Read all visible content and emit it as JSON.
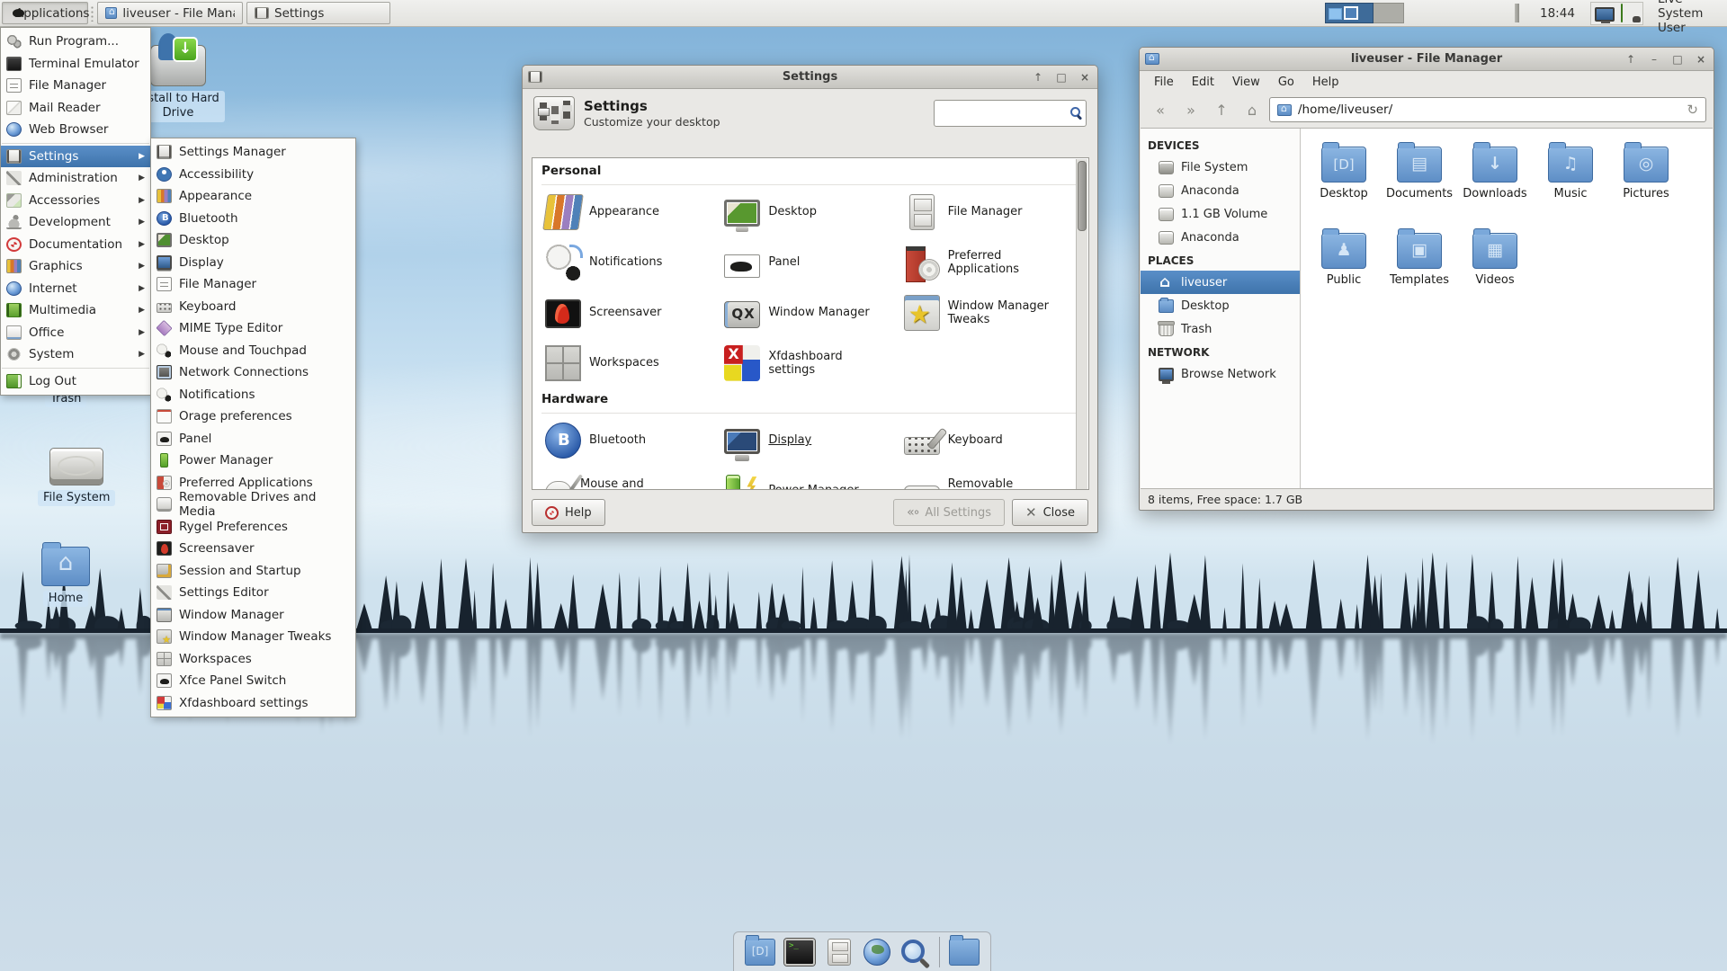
{
  "panel": {
    "applications_label": "Applications",
    "taskbar": [
      {
        "icon": "home-folder-icon",
        "label": "liveuser - File Manager"
      },
      {
        "icon": "settings-icon",
        "label": "Settings"
      }
    ],
    "workspaces": {
      "count": 2,
      "active": 1
    },
    "clock": "18:44",
    "tray": [
      {
        "icon": "display-tray-icon"
      },
      {
        "icon": "power-tray-icon"
      }
    ],
    "user_label": "Live System User"
  },
  "apps_menu": {
    "items": [
      {
        "icon": "run-program-icon",
        "label": "Run Program..."
      },
      {
        "icon": "terminal-icon",
        "label": "Terminal Emulator"
      },
      {
        "icon": "file-manager-icon",
        "label": "File Manager"
      },
      {
        "icon": "mail-icon",
        "label": "Mail Reader"
      },
      {
        "icon": "web-browser-icon",
        "label": "Web Browser"
      },
      {
        "icon": "settings-icon",
        "label": "Settings",
        "submenu": true,
        "highlighted": true
      },
      {
        "icon": "administration-icon",
        "label": "Administration",
        "submenu": true
      },
      {
        "icon": "accessories-icon",
        "label": "Accessories",
        "submenu": true
      },
      {
        "icon": "development-icon",
        "label": "Development",
        "submenu": true
      },
      {
        "icon": "documentation-icon",
        "label": "Documentation",
        "submenu": true
      },
      {
        "icon": "graphics-icon",
        "label": "Graphics",
        "submenu": true
      },
      {
        "icon": "internet-icon",
        "label": "Internet",
        "submenu": true
      },
      {
        "icon": "multimedia-icon",
        "label": "Multimedia",
        "submenu": true
      },
      {
        "icon": "office-icon",
        "label": "Office",
        "submenu": true
      },
      {
        "icon": "system-icon",
        "label": "System",
        "submenu": true
      },
      {
        "icon": "log-out-icon",
        "label": "Log Out"
      }
    ]
  },
  "settings_submenu": {
    "items": [
      {
        "icon": "settings-manager-icon",
        "label": "Settings Manager"
      },
      {
        "icon": "accessibility-icon",
        "label": "Accessibility"
      },
      {
        "icon": "appearance-icon",
        "label": "Appearance"
      },
      {
        "icon": "bluetooth-icon",
        "label": "Bluetooth"
      },
      {
        "icon": "desktop-icon",
        "label": "Desktop"
      },
      {
        "icon": "display-icon",
        "label": "Display"
      },
      {
        "icon": "file-manager-icon",
        "label": "File Manager"
      },
      {
        "icon": "keyboard-icon",
        "label": "Keyboard"
      },
      {
        "icon": "mime-type-icon",
        "label": "MIME Type Editor"
      },
      {
        "icon": "mouse-touchpad-icon",
        "label": "Mouse and Touchpad"
      },
      {
        "icon": "network-icon",
        "label": "Network Connections"
      },
      {
        "icon": "notifications-icon",
        "label": "Notifications"
      },
      {
        "icon": "orage-calendar-icon",
        "label": "Orage preferences"
      },
      {
        "icon": "panel-icon",
        "label": "Panel"
      },
      {
        "icon": "power-manager-icon",
        "label": "Power Manager"
      },
      {
        "icon": "preferred-applications-icon",
        "label": "Preferred Applications"
      },
      {
        "icon": "removable-drives-icon",
        "label": "Removable Drives and Media"
      },
      {
        "icon": "rygel-icon",
        "label": "Rygel Preferences"
      },
      {
        "icon": "screensaver-icon",
        "label": "Screensaver"
      },
      {
        "icon": "session-startup-icon",
        "label": "Session and Startup"
      },
      {
        "icon": "settings-editor-icon",
        "label": "Settings Editor"
      },
      {
        "icon": "window-manager-icon",
        "label": "Window Manager"
      },
      {
        "icon": "window-manager-tweaks-icon",
        "label": "Window Manager Tweaks"
      },
      {
        "icon": "workspaces-icon",
        "label": "Workspaces"
      },
      {
        "icon": "xfce-panel-switch-icon",
        "label": "Xfce Panel Switch"
      },
      {
        "icon": "xfdashboard-icon",
        "label": "Xfdashboard settings"
      }
    ]
  },
  "settings_window": {
    "title": "Settings",
    "heading": "Settings",
    "subheading": "Customize your desktop",
    "search_value": "",
    "sections": [
      {
        "title": "Personal",
        "tiles": [
          {
            "icon": "appearance-icon",
            "label": "Appearance"
          },
          {
            "icon": "desktop-icon",
            "label": "Desktop"
          },
          {
            "icon": "file-manager-icon",
            "label": "File Manager"
          },
          {
            "icon": "notifications-icon",
            "label": "Notifications"
          },
          {
            "icon": "panel-icon",
            "label": "Panel"
          },
          {
            "icon": "preferred-applications-icon",
            "label": "Preferred Applications"
          },
          {
            "icon": "screensaver-icon",
            "label": "Screensaver"
          },
          {
            "icon": "window-manager-icon",
            "label": "Window Manager"
          },
          {
            "icon": "window-manager-tweaks-icon",
            "label": "Window Manager Tweaks"
          },
          {
            "icon": "workspaces-icon",
            "label": "Workspaces"
          },
          {
            "icon": "xfdashboard-icon",
            "label": "Xfdashboard settings"
          }
        ]
      },
      {
        "title": "Hardware",
        "tiles": [
          {
            "icon": "bluetooth-icon",
            "label": "Bluetooth"
          },
          {
            "icon": "display-icon",
            "label": "Display",
            "focused": true
          },
          {
            "icon": "keyboard-icon",
            "label": "Keyboard"
          },
          {
            "icon": "mouse-touchpad-icon",
            "label": "Mouse and Touchpad"
          },
          {
            "icon": "power-manager-icon",
            "label": "Power Manager"
          },
          {
            "icon": "removable-drives-icon",
            "label": "Removable Drives and Media"
          }
        ]
      }
    ],
    "buttons": {
      "help": "Help",
      "all_settings": "All Settings",
      "close": "Close"
    }
  },
  "file_manager": {
    "title": "liveuser - File Manager",
    "menu": [
      "File",
      "Edit",
      "View",
      "Go",
      "Help"
    ],
    "path": "/home/liveuser/",
    "sidebar": {
      "sections": [
        {
          "title": "DEVICES",
          "items": [
            {
              "icon": "hard-drive-icon",
              "label": "File System"
            },
            {
              "icon": "drive-icon",
              "label": "Anaconda"
            },
            {
              "icon": "drive-icon",
              "label": "1.1 GB Volume"
            },
            {
              "icon": "drive-icon",
              "label": "Anaconda"
            }
          ]
        },
        {
          "title": "PLACES",
          "items": [
            {
              "icon": "home-icon",
              "label": "liveuser",
              "selected": true
            },
            {
              "icon": "folder-icon",
              "label": "Desktop"
            },
            {
              "icon": "trash-icon",
              "label": "Trash"
            }
          ]
        },
        {
          "title": "NETWORK",
          "items": [
            {
              "icon": "network-icon",
              "label": "Browse Network"
            }
          ]
        }
      ]
    },
    "folders": [
      "Desktop",
      "Documents",
      "Downloads",
      "Music",
      "Pictures",
      "Public",
      "Templates",
      "Videos"
    ],
    "statusbar": "8 items, Free space: 1.7 GB"
  },
  "desktop": {
    "icons": [
      {
        "icon": "install-drive-icon",
        "label": "Install to Hard Drive"
      },
      {
        "icon": "trash-icon",
        "label": "Trash"
      },
      {
        "icon": "hard-drive-icon",
        "label": "File System"
      },
      {
        "icon": "home-folder-icon",
        "label": "Home"
      }
    ]
  },
  "dock": {
    "items": [
      {
        "icon": "show-desktop-icon"
      },
      {
        "icon": "terminal-icon"
      },
      {
        "icon": "file-manager-icon"
      },
      {
        "icon": "web-browser-icon"
      },
      {
        "icon": "search-icon"
      },
      {
        "icon": "folder-icon"
      }
    ]
  },
  "colors": {
    "selection": "#4a80b8",
    "panel_bg": "#e8e8e6",
    "window_bg": "#e9e8e5",
    "workspace_active": "#3e6b99",
    "folder_blue": "#6f9cce"
  }
}
